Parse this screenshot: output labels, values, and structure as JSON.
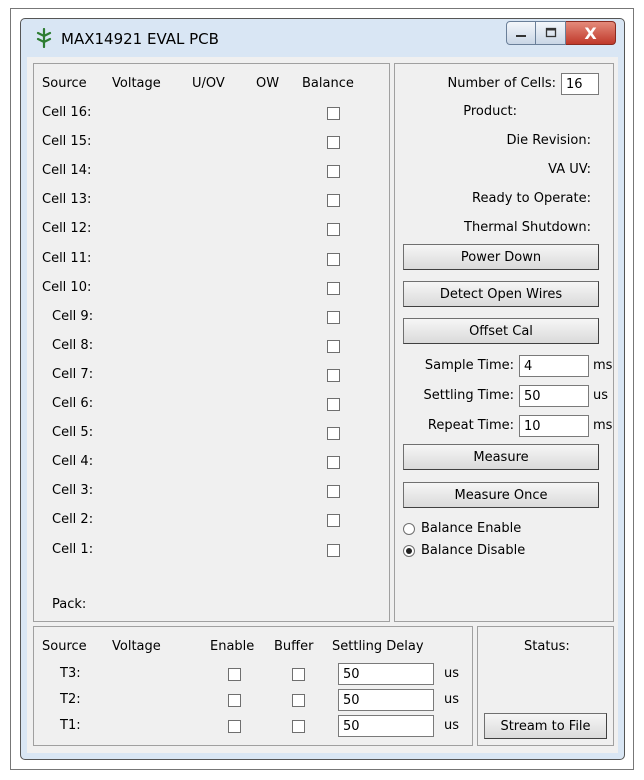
{
  "window": {
    "title": "MAX14921 EVAL PCB",
    "close_glyph": "X",
    "icon": "pcb-app-icon"
  },
  "cells": {
    "headers": {
      "source": "Source",
      "voltage": "Voltage",
      "uov": "U/OV",
      "ow": "OW",
      "balance": "Balance"
    },
    "rows": [
      "Cell 16:",
      "Cell 15:",
      "Cell 14:",
      "Cell 13:",
      "Cell 12:",
      "Cell 11:",
      "Cell 10:",
      "Cell 9:",
      "Cell 8:",
      "Cell 7:",
      "Cell 6:",
      "Cell 5:",
      "Cell 4:",
      "Cell 3:",
      "Cell 2:",
      "Cell 1:"
    ],
    "pack_label": "Pack:"
  },
  "info": {
    "num_cells_label": "Number of Cells:",
    "num_cells_value": "16",
    "product_label": "Product:",
    "die_revision_label": "Die Revision:",
    "va_uv_label": "VA UV:",
    "ready_label": "Ready to Operate:",
    "thermal_label": "Thermal Shutdown:",
    "power_down_label": "Power Down",
    "detect_open_label": "Detect Open Wires",
    "offset_cal_label": "Offset Cal",
    "sample_time_label": "Sample Time:",
    "sample_time_value": "4",
    "sample_time_unit": "ms",
    "settling_time_label": "Settling Time:",
    "settling_time_value": "50",
    "settling_time_unit": "us",
    "repeat_time_label": "Repeat Time:",
    "repeat_time_value": "10",
    "repeat_time_unit": "ms",
    "measure_label": "Measure",
    "measure_once_label": "Measure Once",
    "balance_enable_label": "Balance Enable",
    "balance_disable_label": "Balance Disable",
    "balance_selected": "disable"
  },
  "temps": {
    "headers": {
      "source": "Source",
      "voltage": "Voltage",
      "enable": "Enable",
      "buffer": "Buffer",
      "settling_delay": "Settling Delay"
    },
    "rows": [
      {
        "label": "T3:",
        "delay": "50",
        "unit": "us"
      },
      {
        "label": "T2:",
        "delay": "50",
        "unit": "us"
      },
      {
        "label": "T1:",
        "delay": "50",
        "unit": "us"
      }
    ]
  },
  "status": {
    "label": "Status:",
    "stream_label": "Stream to File"
  },
  "colors": {
    "window_frame": "#d9e6f4",
    "client_bg": "#f0f0f0",
    "close_button": "#c0392b"
  }
}
